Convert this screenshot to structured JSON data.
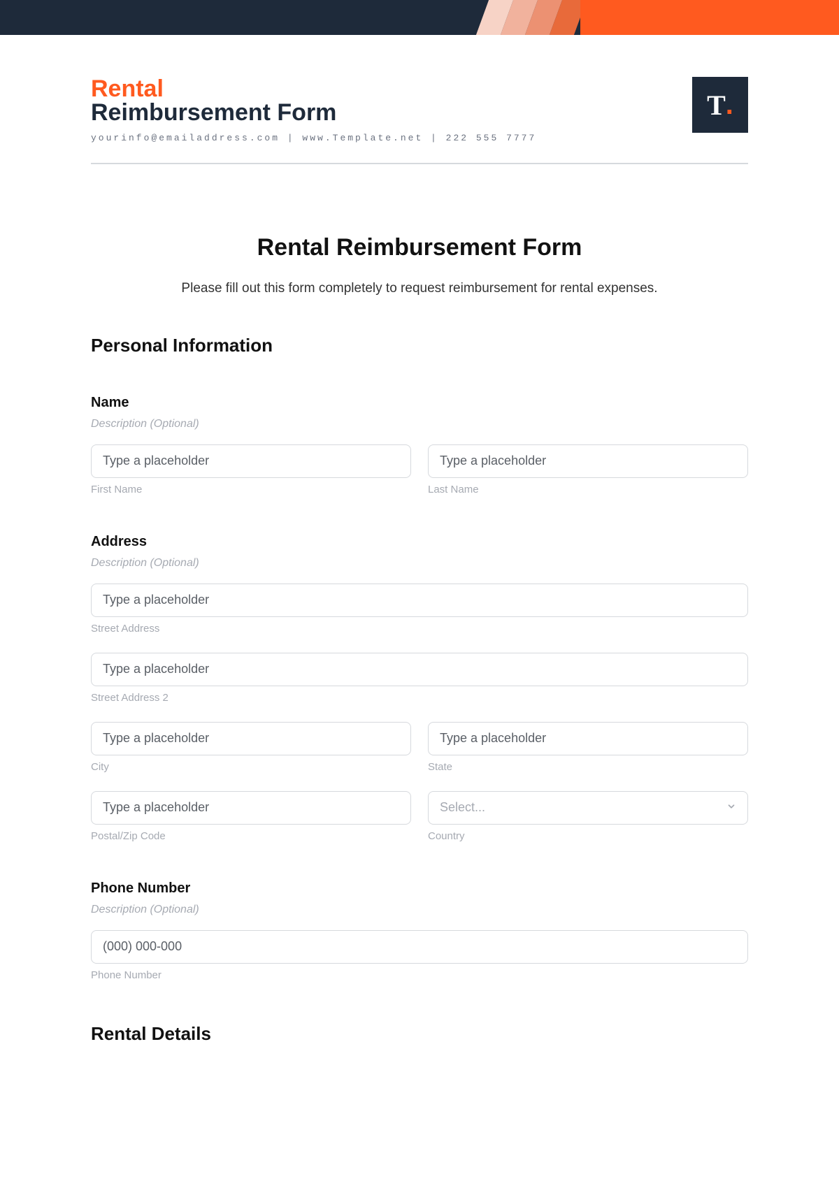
{
  "header": {
    "brand_line1": "Rental",
    "brand_line2": "Reimbursement Form",
    "contact": "yourinfo@emailaddress.com | www.Template.net | 222 555 7777",
    "logo_text": "T",
    "logo_dot": "."
  },
  "form": {
    "title": "Rental Reimbursement Form",
    "intro": "Please fill out this form completely to request reimbursement for rental expenses."
  },
  "sections": {
    "personal": "Personal Information",
    "rental": "Rental Details"
  },
  "name": {
    "label": "Name",
    "desc": "Description (Optional)",
    "first_placeholder": "Type a placeholder",
    "first_sub": "First Name",
    "last_placeholder": "Type a placeholder",
    "last_sub": "Last Name"
  },
  "address": {
    "label": "Address",
    "desc": "Description (Optional)",
    "street_placeholder": "Type a placeholder",
    "street_sub": "Street Address",
    "street2_placeholder": "Type a placeholder",
    "street2_sub": "Street Address 2",
    "city_placeholder": "Type a placeholder",
    "city_sub": "City",
    "state_placeholder": "Type a placeholder",
    "state_sub": "State",
    "postal_placeholder": "Type a placeholder",
    "postal_sub": "Postal/Zip Code",
    "country_placeholder": "Select...",
    "country_sub": "Country"
  },
  "phone": {
    "label": "Phone Number",
    "desc": "Description (Optional)",
    "placeholder": "(000) 000-000",
    "sub": "Phone Number"
  }
}
